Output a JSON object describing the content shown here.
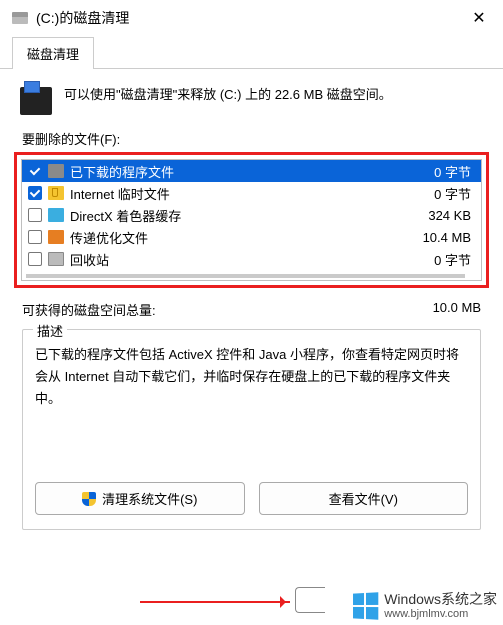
{
  "titlebar": {
    "title": "(C:)的磁盘清理"
  },
  "tab_label": "磁盘清理",
  "intro_text": "可以使用\"磁盘清理\"来释放  (C:) 上的 22.6 MB 磁盘空间。",
  "files_label": "要删除的文件(F):",
  "files": [
    {
      "name": "已下载的程序文件",
      "size": "0 字节",
      "checked": true,
      "selected": true,
      "icon": "ico-prog"
    },
    {
      "name": "Internet 临时文件",
      "size": "0 字节",
      "checked": true,
      "selected": false,
      "icon": "ico-temp"
    },
    {
      "name": "DirectX 着色器缓存",
      "size": "324 KB",
      "checked": false,
      "selected": false,
      "icon": "ico-dx"
    },
    {
      "name": "传递优化文件",
      "size": "10.4 MB",
      "checked": false,
      "selected": false,
      "icon": "ico-opt"
    },
    {
      "name": "回收站",
      "size": "0 字节",
      "checked": false,
      "selected": false,
      "icon": "ico-bin"
    }
  ],
  "total": {
    "label": "可获得的磁盘空间总量:",
    "value": "10.0 MB"
  },
  "desc": {
    "legend": "描述",
    "text": "已下载的程序文件包括 ActiveX 控件和 Java 小程序，你查看特定网页时将会从 Internet 自动下载它们，并临时保存在硬盘上的已下载的程序文件夹中。"
  },
  "buttons": {
    "clean_system": "清理系统文件(S)",
    "view_files": "查看文件(V)"
  },
  "watermark": {
    "line1": "Windows系统之家",
    "line2": "www.bjmlmv.com"
  }
}
